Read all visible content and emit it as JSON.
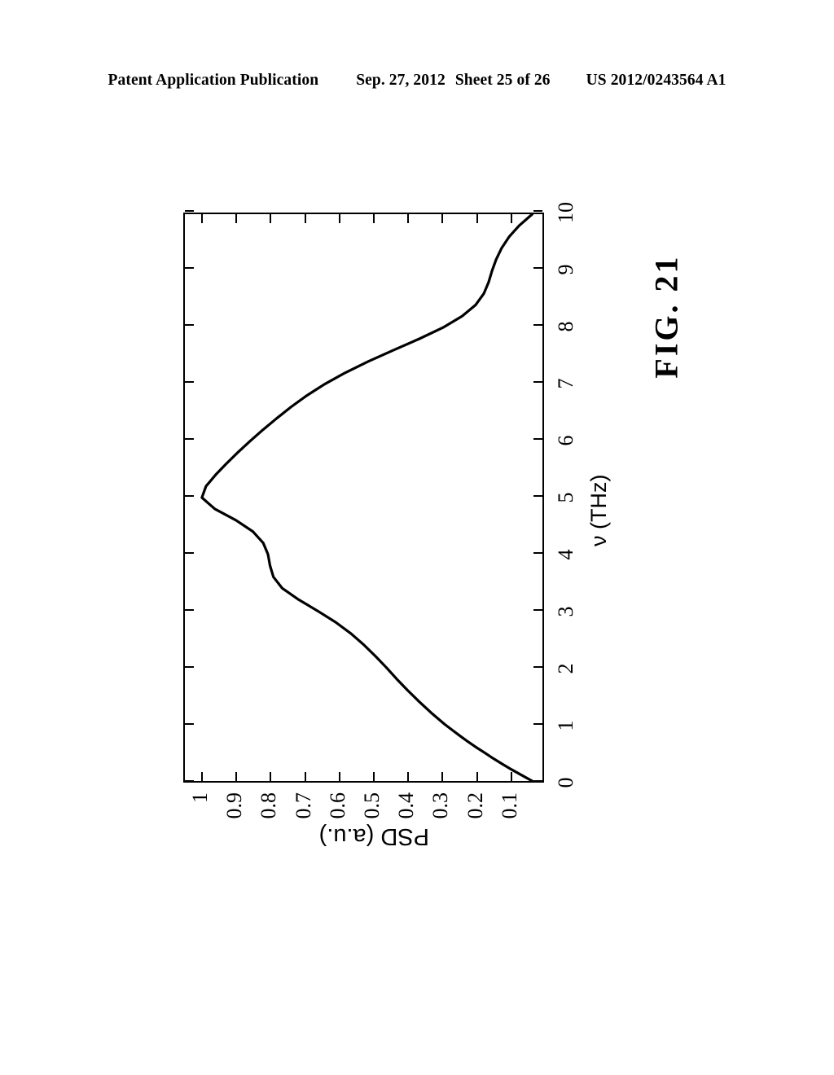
{
  "header": {
    "publication": "Patent Application Publication",
    "date": "Sep. 27, 2012",
    "sheet": "Sheet 25 of 26",
    "number": "US 2012/0243564 A1"
  },
  "figure": {
    "caption": "FIG. 21",
    "rotation_degrees": -90
  },
  "chart_data": {
    "type": "line",
    "title": "",
    "subtitle": "",
    "xlabel": "ν (THz)",
    "ylabel": "PSD (a.u.)",
    "xlim": [
      0,
      10
    ],
    "ylim": [
      0,
      1.05
    ],
    "grid": false,
    "legend": null,
    "line_color": "#000000",
    "xticks": [
      0,
      1,
      2,
      3,
      4,
      5,
      6,
      7,
      8,
      9,
      10
    ],
    "xticklabels": [
      "0",
      "1",
      "2",
      "3",
      "4",
      "5",
      "6",
      "7",
      "8",
      "9",
      "10"
    ],
    "yticks": [
      0.1,
      0.2,
      0.3,
      0.4,
      0.5,
      0.6,
      0.7,
      0.8,
      0.9,
      1
    ],
    "yticklabels": [
      "0.1",
      "0.2",
      "0.3",
      "0.4",
      "0.5",
      "0.6",
      "0.7",
      "0.8",
      "0.9",
      "1"
    ],
    "series": [
      {
        "name": "PSD",
        "x": [
          0.0,
          0.1,
          0.2,
          0.3,
          0.4,
          0.5,
          0.6,
          0.7,
          0.8,
          0.9,
          1.0,
          1.2,
          1.4,
          1.6,
          1.8,
          2.0,
          2.2,
          2.4,
          2.6,
          2.8,
          3.0,
          3.2,
          3.4,
          3.6,
          3.8,
          4.0,
          4.2,
          4.4,
          4.6,
          4.8,
          5.0,
          5.2,
          5.4,
          5.6,
          5.8,
          6.0,
          6.2,
          6.4,
          6.6,
          6.8,
          7.0,
          7.2,
          7.4,
          7.6,
          7.8,
          8.0,
          8.2,
          8.4,
          8.6,
          8.8,
          9.0,
          9.2,
          9.4,
          9.6,
          9.8,
          10.0
        ],
        "y": [
          0.03,
          0.06,
          0.09,
          0.118,
          0.145,
          0.17,
          0.196,
          0.22,
          0.243,
          0.265,
          0.287,
          0.326,
          0.362,
          0.396,
          0.428,
          0.458,
          0.49,
          0.524,
          0.562,
          0.607,
          0.66,
          0.716,
          0.764,
          0.79,
          0.8,
          0.806,
          0.82,
          0.85,
          0.9,
          0.962,
          1.0,
          0.988,
          0.96,
          0.928,
          0.894,
          0.858,
          0.82,
          0.78,
          0.738,
          0.692,
          0.64,
          0.58,
          0.512,
          0.438,
          0.362,
          0.292,
          0.236,
          0.196,
          0.172,
          0.158,
          0.148,
          0.136,
          0.12,
          0.098,
          0.068,
          0.03
        ]
      }
    ]
  }
}
